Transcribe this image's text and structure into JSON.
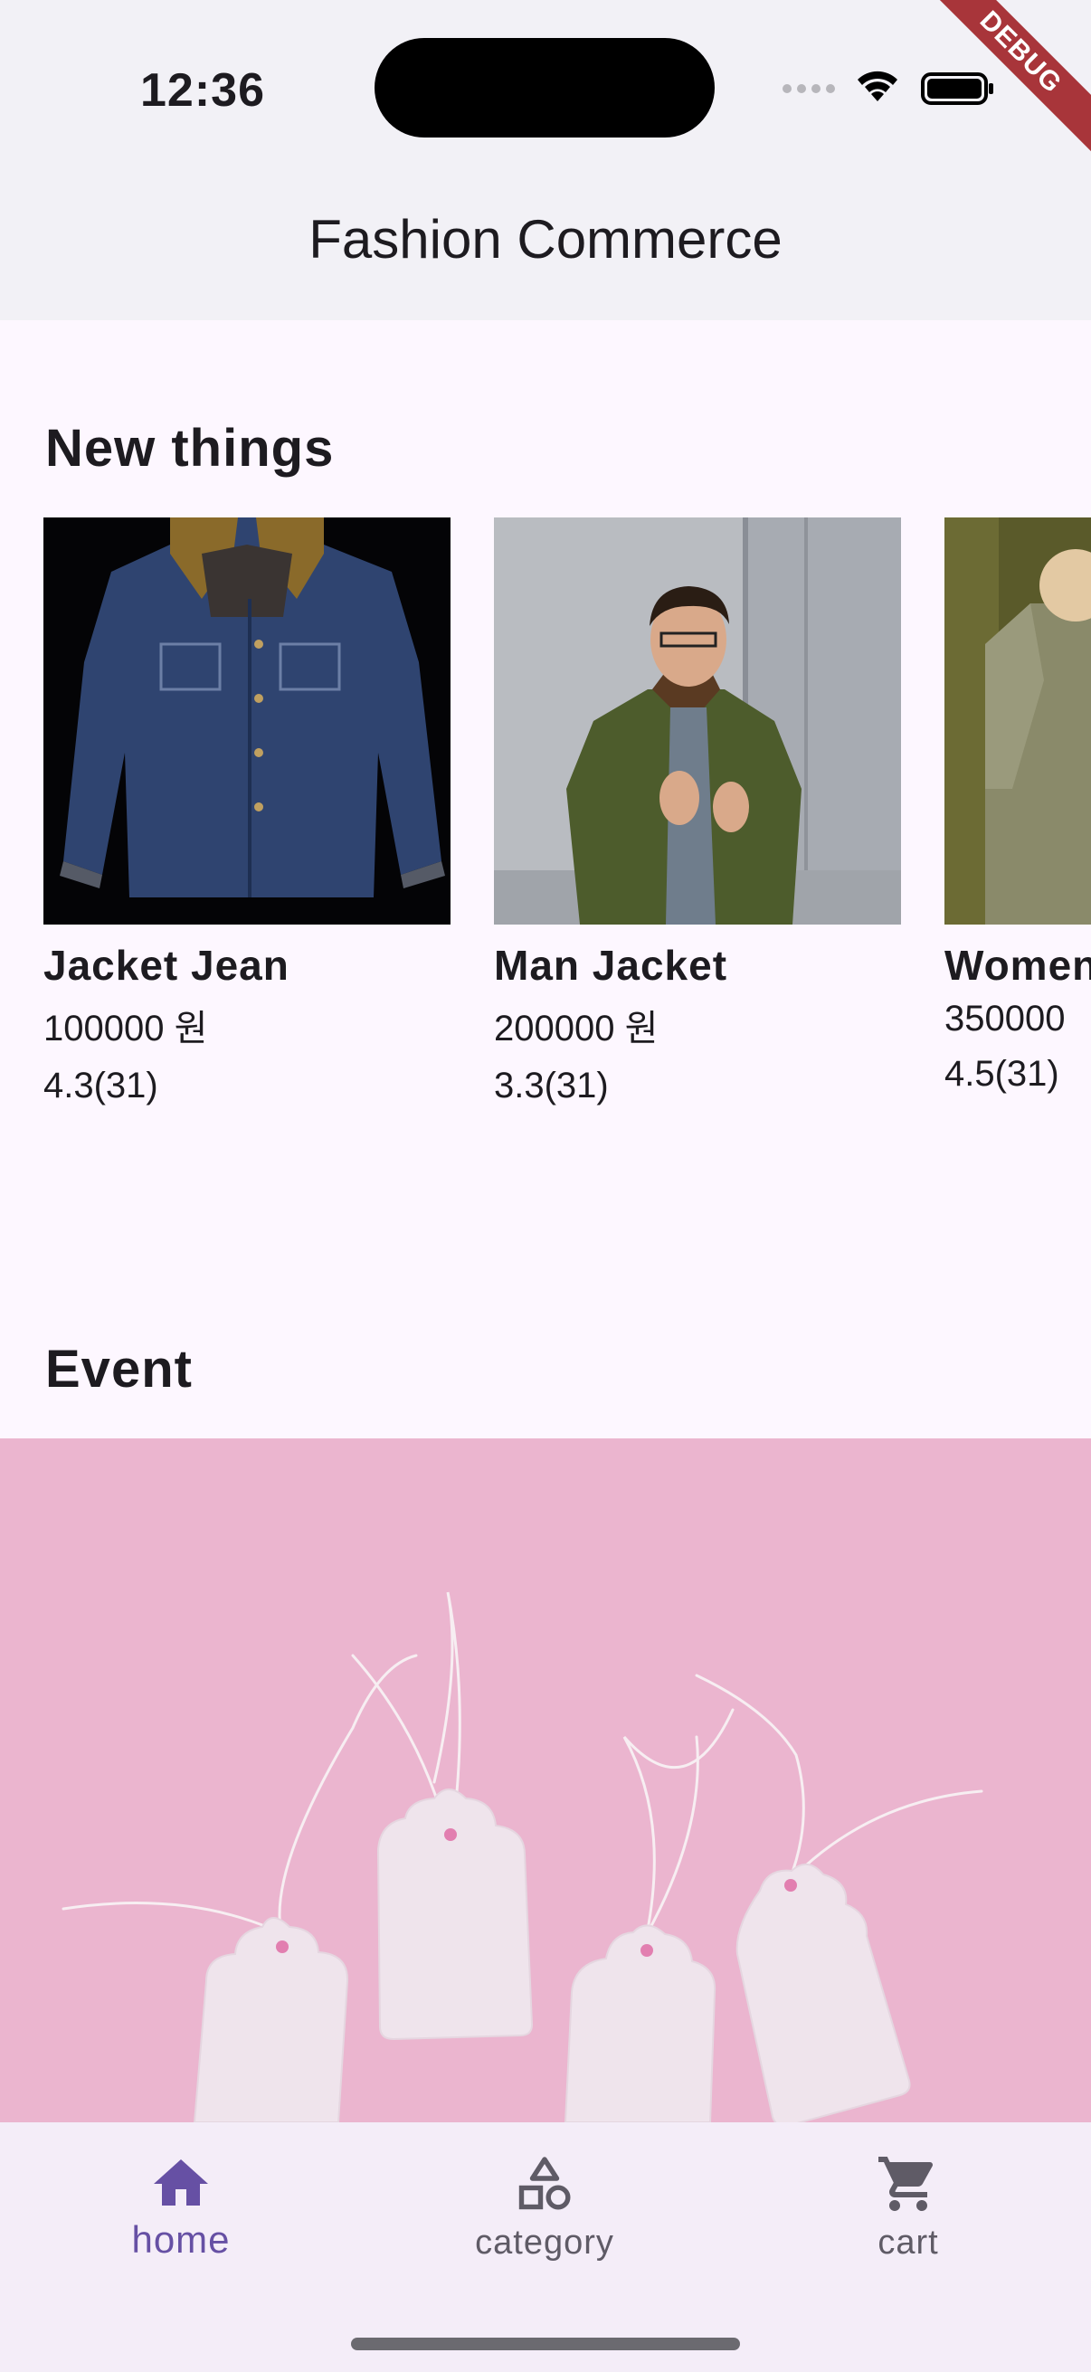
{
  "status_bar": {
    "time": "12:36"
  },
  "debug_banner": "DEBUG",
  "app_bar": {
    "title": "Fashion Commerce"
  },
  "sections": {
    "new_things": "New things",
    "event": "Event"
  },
  "products": [
    {
      "name": "Jacket Jean",
      "price": "100000 원",
      "rating": "4.3(31)"
    },
    {
      "name": "Man Jacket",
      "price": "200000 원",
      "rating": "3.3(31)"
    },
    {
      "name": "Women",
      "price": "350000",
      "rating": "4.5(31)"
    }
  ],
  "bottom_nav": {
    "items": [
      {
        "label": "home",
        "icon": "home-icon",
        "active": true
      },
      {
        "label": "category",
        "icon": "category-icon",
        "active": false
      },
      {
        "label": "cart",
        "icon": "cart-icon",
        "active": false
      }
    ]
  },
  "colors": {
    "accent": "#6650a4",
    "background": "#fdf7ff",
    "app_bar": "#f2f1f6",
    "nav_bar": "#f4edf8",
    "event_bg": "#eab4d0"
  }
}
